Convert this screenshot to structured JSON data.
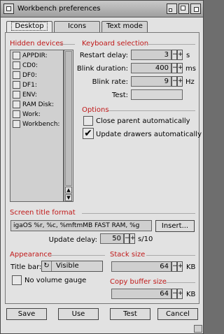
{
  "window": {
    "title": "Workbench preferences"
  },
  "tabs": [
    {
      "label": "Desktop",
      "active": true
    },
    {
      "label": "Icons",
      "active": false
    },
    {
      "label": "Text mode",
      "active": false
    }
  ],
  "hidden_devices": {
    "title": "Hidden devices",
    "items": [
      "APPDIR:",
      "CD0:",
      "DF0:",
      "DF1:",
      "ENV:",
      "RAM Disk:",
      "Work:",
      "Workbench:"
    ]
  },
  "keyboard": {
    "title": "Keyboard selection",
    "restart_delay": {
      "label": "Restart delay:",
      "value": "3",
      "unit": "s"
    },
    "blink_duration": {
      "label": "Blink duration:",
      "value": "400",
      "unit": "ms"
    },
    "blink_rate": {
      "label": "Blink rate:",
      "value": "9",
      "unit": "Hz"
    },
    "test": {
      "label": "Test:",
      "value": ""
    }
  },
  "options": {
    "title": "Options",
    "close_parent": {
      "label": "Close parent automatically",
      "checked": false
    },
    "update_drawers": {
      "label": "Update drawers automatically",
      "checked": true
    }
  },
  "screen_title": {
    "title": "Screen title format",
    "value": "igaOS %r, %c, %mftmMB FAST RAM, %g",
    "insert_label": "Insert...",
    "update_delay": {
      "label": "Update delay:",
      "value": "50",
      "unit": "s/10"
    }
  },
  "appearance": {
    "title": "Appearance",
    "title_bar_label": "Title bar:",
    "title_bar_value": "Visible",
    "no_volume_gauge": {
      "label": "No volume gauge",
      "checked": false
    }
  },
  "stack_size": {
    "title": "Stack size",
    "value": "64",
    "unit": "KB"
  },
  "copy_buffer": {
    "title": "Copy buffer size",
    "value": "64",
    "unit": "KB"
  },
  "buttons": {
    "save": "Save",
    "use": "Use",
    "test": "Test",
    "cancel": "Cancel"
  },
  "colors": {
    "section_title": "#c01818",
    "window_bg": "#e2e2e2"
  }
}
